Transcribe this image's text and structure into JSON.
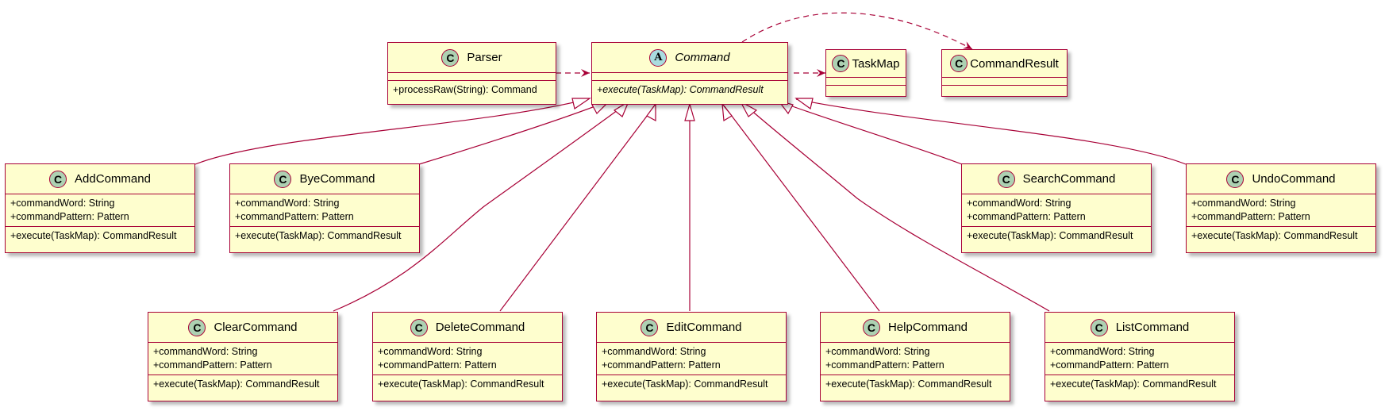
{
  "diagram": {
    "type": "uml-class-diagram",
    "colors": {
      "line": "#A80036",
      "fill": "#FEFECE",
      "class_badge": "#ADD1B2",
      "abstract_badge": "#A9DCDF"
    },
    "classes": {
      "parser": {
        "badge": "C",
        "name": "Parser",
        "attributes": [],
        "methods": [
          "+processRaw(String): Command"
        ]
      },
      "command": {
        "badge": "A",
        "name": "Command",
        "abstract": true,
        "attributes": [],
        "methods": [
          "+execute(TaskMap): CommandResult"
        ]
      },
      "taskmap": {
        "badge": "C",
        "name": "TaskMap",
        "attributes": [],
        "methods": []
      },
      "commandresult": {
        "badge": "C",
        "name": "CommandResult",
        "attributes": [],
        "methods": []
      },
      "add": {
        "badge": "C",
        "name": "AddCommand",
        "attributes": [
          "+commandWord: String",
          "+commandPattern: Pattern"
        ],
        "methods": [
          "+execute(TaskMap): CommandResult"
        ]
      },
      "bye": {
        "badge": "C",
        "name": "ByeCommand",
        "attributes": [
          "+commandWord: String",
          "+commandPattern: Pattern"
        ],
        "methods": [
          "+execute(TaskMap): CommandResult"
        ]
      },
      "search": {
        "badge": "C",
        "name": "SearchCommand",
        "attributes": [
          "+commandWord: String",
          "+commandPattern: Pattern"
        ],
        "methods": [
          "+execute(TaskMap): CommandResult"
        ]
      },
      "undo": {
        "badge": "C",
        "name": "UndoCommand",
        "attributes": [
          "+commandWord: String",
          "+commandPattern: Pattern"
        ],
        "methods": [
          "+execute(TaskMap): CommandResult"
        ]
      },
      "clear": {
        "badge": "C",
        "name": "ClearCommand",
        "attributes": [
          "+commandWord: String",
          "+commandPattern: Pattern"
        ],
        "methods": [
          "+execute(TaskMap): CommandResult"
        ]
      },
      "delete": {
        "badge": "C",
        "name": "DeleteCommand",
        "attributes": [
          "+commandWord: String",
          "+commandPattern: Pattern"
        ],
        "methods": [
          "+execute(TaskMap): CommandResult"
        ]
      },
      "edit": {
        "badge": "C",
        "name": "EditCommand",
        "attributes": [
          "+commandWord: String",
          "+commandPattern: Pattern"
        ],
        "methods": [
          "+execute(TaskMap): CommandResult"
        ]
      },
      "help": {
        "badge": "C",
        "name": "HelpCommand",
        "attributes": [
          "+commandWord: String",
          "+commandPattern: Pattern"
        ],
        "methods": [
          "+execute(TaskMap): CommandResult"
        ]
      },
      "list": {
        "badge": "C",
        "name": "ListCommand",
        "attributes": [
          "+commandWord: String",
          "+commandPattern: Pattern"
        ],
        "methods": [
          "+execute(TaskMap): CommandResult"
        ]
      }
    },
    "relations": [
      {
        "from": "Parser",
        "to": "Command",
        "kind": "dependency"
      },
      {
        "from": "Command",
        "to": "TaskMap",
        "kind": "dependency"
      },
      {
        "from": "Command",
        "to": "CommandResult",
        "kind": "dependency"
      },
      {
        "from": "AddCommand",
        "to": "Command",
        "kind": "inheritance"
      },
      {
        "from": "ByeCommand",
        "to": "Command",
        "kind": "inheritance"
      },
      {
        "from": "ClearCommand",
        "to": "Command",
        "kind": "inheritance"
      },
      {
        "from": "DeleteCommand",
        "to": "Command",
        "kind": "inheritance"
      },
      {
        "from": "EditCommand",
        "to": "Command",
        "kind": "inheritance"
      },
      {
        "from": "HelpCommand",
        "to": "Command",
        "kind": "inheritance"
      },
      {
        "from": "ListCommand",
        "to": "Command",
        "kind": "inheritance"
      },
      {
        "from": "SearchCommand",
        "to": "Command",
        "kind": "inheritance"
      },
      {
        "from": "UndoCommand",
        "to": "Command",
        "kind": "inheritance"
      }
    ]
  }
}
